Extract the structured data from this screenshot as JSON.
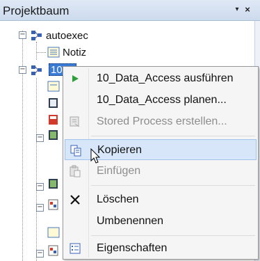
{
  "panel": {
    "title": "Projektbaum",
    "pin_glyph": "▾",
    "close_glyph": "×"
  },
  "tree": {
    "root_label": "autoexec",
    "child_label": "Notiz",
    "selected_label": "10"
  },
  "context_menu": {
    "items": [
      {
        "label": "10_Data_Access ausführen",
        "icon": "play-icon",
        "enabled": true
      },
      {
        "label": "10_Data_Access planen...",
        "icon": "",
        "enabled": true
      },
      {
        "label": "Stored Process erstellen...",
        "icon": "stored-process-icon",
        "enabled": false
      },
      {
        "label": "Kopieren",
        "icon": "copy-icon",
        "enabled": true,
        "highlighted": true
      },
      {
        "label": "Einfügen",
        "icon": "paste-icon",
        "enabled": false
      },
      {
        "label": "Löschen",
        "icon": "delete-icon",
        "enabled": true
      },
      {
        "label": "Umbenennen",
        "icon": "",
        "enabled": true
      },
      {
        "label": "Eigenschaften",
        "icon": "properties-icon",
        "enabled": true
      }
    ]
  },
  "colors": {
    "accent": "#3a7bd5",
    "highlight": "#d7e7f9",
    "play": "#2e9e3a"
  }
}
